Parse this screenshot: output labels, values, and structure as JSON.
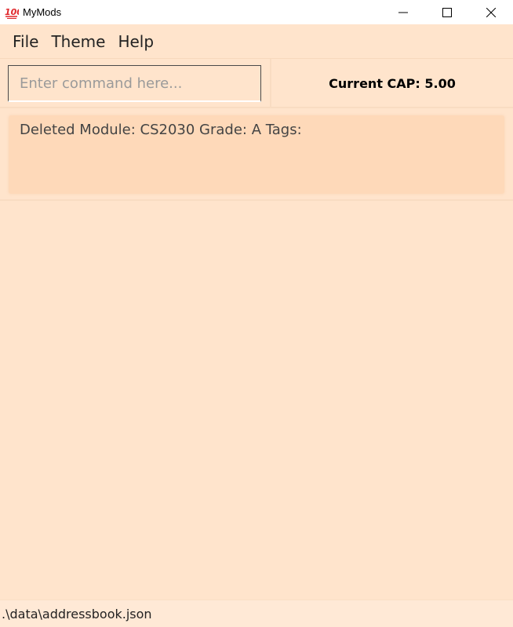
{
  "window": {
    "title": "MyMods",
    "icon": "hundred-points-icon"
  },
  "menu": {
    "items": [
      "File",
      "Theme",
      "Help"
    ]
  },
  "command": {
    "placeholder": "Enter command here...",
    "value": ""
  },
  "cap": {
    "label": "Current CAP: 5.00"
  },
  "result": {
    "message": "Deleted Module: CS2030 Grade: A Tags:"
  },
  "status": {
    "file_path": ".\\data\\addressbook.json"
  },
  "colors": {
    "background": "#ffe4cc",
    "result_box": "#fed9b9"
  }
}
